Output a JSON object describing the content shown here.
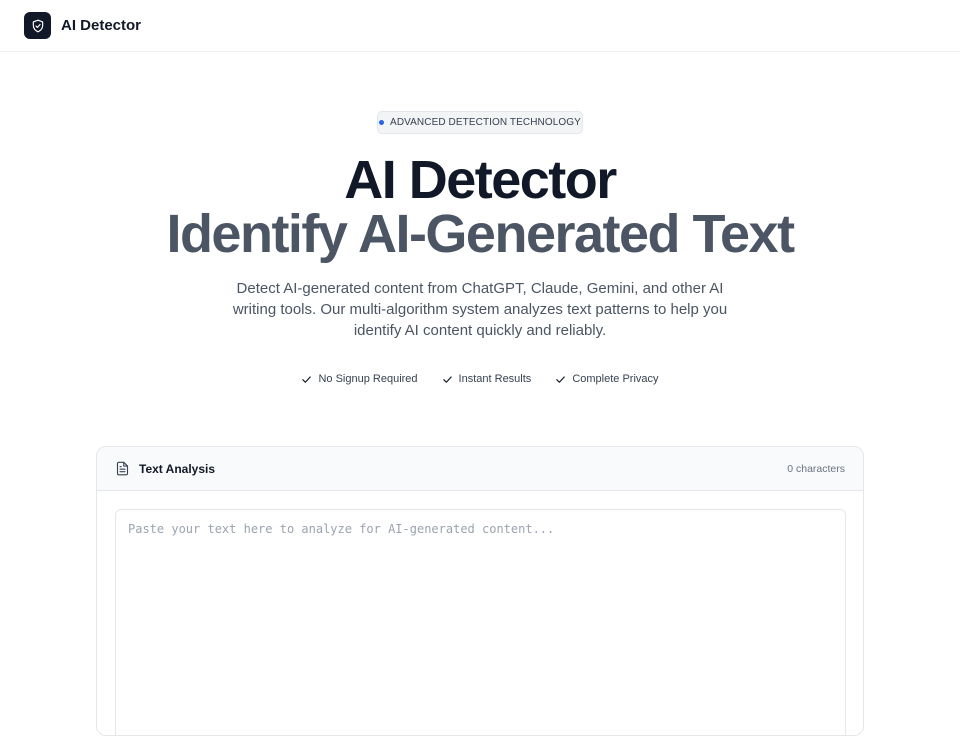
{
  "header": {
    "brand": "AI Detector",
    "logo_icon": "shield-check-icon"
  },
  "hero": {
    "badge": "ADVANCED DETECTION TECHNOLOGY",
    "title": "AI Detector",
    "subtitle": "Identify AI-Generated Text",
    "description": "Detect AI-generated content from ChatGPT, Claude, Gemini, and other AI writing tools. Our multi-algorithm system analyzes text patterns to help you identify AI content quickly and reliably.",
    "features": [
      "No Signup Required",
      "Instant Results",
      "Complete Privacy"
    ]
  },
  "analysis": {
    "title": "Text Analysis",
    "title_icon": "document-icon",
    "char_count": "0 characters",
    "placeholder": "Paste your text here to analyze for AI-generated content...",
    "value": ""
  },
  "colors": {
    "brand_dark": "#111827",
    "accent_dot": "#2563eb",
    "muted_text": "#4b5563"
  }
}
